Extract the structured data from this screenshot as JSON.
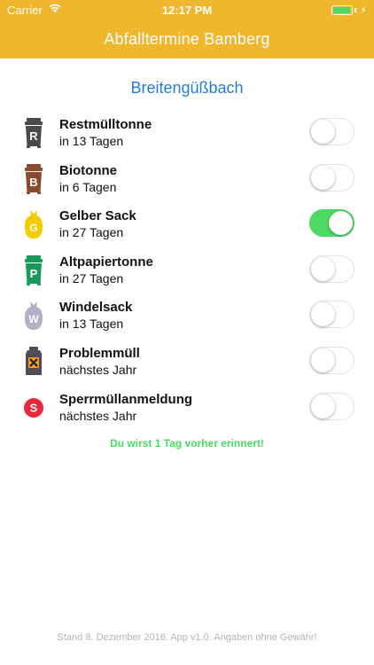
{
  "status_bar": {
    "carrier": "Carrier",
    "time": "12:17 PM",
    "battery_color": "#4cd964"
  },
  "header": {
    "title": "Abfalltermine Bamberg",
    "background": "#f0b62d"
  },
  "location": "Breitengüßbach",
  "items": [
    {
      "name": "Restmülltonne",
      "due": "in 13 Tagen",
      "icon": "residual-bin-icon",
      "icon_letter": "R",
      "icon_color": "#4a4a4a",
      "reminder_on": false
    },
    {
      "name": "Biotonne",
      "due": "in 6 Tagen",
      "icon": "organic-bin-icon",
      "icon_letter": "B",
      "icon_color": "#8b4a2b",
      "reminder_on": false
    },
    {
      "name": "Gelber Sack",
      "due": "in 27 Tagen",
      "icon": "yellow-bag-icon",
      "icon_letter": "G",
      "icon_color": "#f5cc00",
      "reminder_on": true
    },
    {
      "name": "Altpapiertonne",
      "due": "in 27 Tagen",
      "icon": "paper-bin-icon",
      "icon_letter": "P",
      "icon_color": "#1a9a5a",
      "reminder_on": false
    },
    {
      "name": "Windelsack",
      "due": "in 13 Tagen",
      "icon": "diaper-bag-icon",
      "icon_letter": "W",
      "icon_color": "#b6b0c6",
      "reminder_on": false
    },
    {
      "name": "Problemmüll",
      "due": "nächstes Jahr",
      "icon": "hazardous-waste-icon",
      "icon_letter": "",
      "icon_color": "#4c4c5a",
      "reminder_on": false
    },
    {
      "name": "Sperrmüllanmeldung",
      "due": "nächstes Jahr",
      "icon": "bulky-waste-icon",
      "icon_letter": "S",
      "icon_color": "#e8283c",
      "reminder_on": false
    }
  ],
  "reminder_note": "Du wirst 1 Tag vorher erinnert!",
  "footer": "Stand 8. Dezember 2016. App v1.0. Angaben ohne Gewähr!",
  "toggle_on_color": "#4cd964"
}
